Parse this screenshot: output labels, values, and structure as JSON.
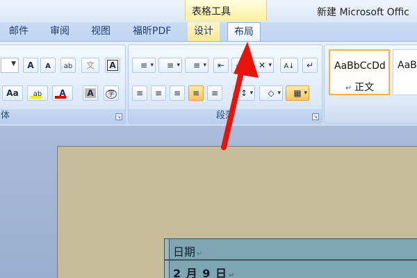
{
  "title_bar": {
    "context_group_label": "表格工具",
    "document_title": "新建 Microsoft Offic"
  },
  "tabs": [
    {
      "label": "邮件"
    },
    {
      "label": "审阅"
    },
    {
      "label": "视图"
    },
    {
      "label": "福昕PDF"
    },
    {
      "label": "设计"
    },
    {
      "label": "布局"
    }
  ],
  "selected_tab": "布局",
  "ribbon": {
    "font_group": {
      "label": "体",
      "buttons": [
        {
          "glyph": "A",
          "icon": "grow-font-icon"
        },
        {
          "glyph": "A",
          "icon": "shrink-font-icon"
        },
        {
          "glyph": "ab",
          "icon": "clear-formatting-icon"
        },
        {
          "glyph": "文",
          "icon": "phonetic-guide-icon"
        },
        {
          "glyph": "A",
          "icon": "character-border-icon"
        },
        {
          "glyph": "Aa",
          "icon": "change-case-icon"
        },
        {
          "glyph": "ab",
          "icon": "text-highlight-icon"
        },
        {
          "glyph": "A",
          "icon": "font-color-icon"
        },
        {
          "glyph": "A",
          "icon": "character-shading-icon"
        },
        {
          "glyph": "字",
          "icon": "enclose-characters-icon"
        }
      ]
    },
    "paragraph_group": {
      "label": "段落",
      "buttons": [
        {
          "glyph": "≡",
          "icon": "bullets-icon"
        },
        {
          "glyph": "≡",
          "icon": "numbering-icon"
        },
        {
          "glyph": "≡",
          "icon": "multilevel-list-icon"
        },
        {
          "glyph": "⇤",
          "icon": "decrease-indent-icon"
        },
        {
          "glyph": "⇥",
          "icon": "increase-indent-icon"
        },
        {
          "glyph": "✕",
          "icon": "chinese-layout-icon"
        },
        {
          "glyph": "A↓",
          "icon": "sort-icon"
        },
        {
          "glyph": "↵",
          "icon": "show-marks-icon"
        },
        {
          "glyph": "≡",
          "icon": "align-left-icon"
        },
        {
          "glyph": "≡",
          "icon": "center-icon"
        },
        {
          "glyph": "≡",
          "icon": "align-right-icon"
        },
        {
          "glyph": "≡",
          "icon": "justify-icon"
        },
        {
          "glyph": "≡",
          "icon": "distributed-icon"
        },
        {
          "glyph": "↕",
          "icon": "line-spacing-icon"
        },
        {
          "glyph": "◇",
          "icon": "shading-icon"
        },
        {
          "glyph": "▦",
          "icon": "borders-icon"
        }
      ]
    },
    "styles_group": {
      "tiles": [
        {
          "sample": "AaBbCcDd",
          "name": "正文",
          "mark": "↵",
          "active": true
        },
        {
          "sample": "AaB",
          "name": "",
          "mark": "",
          "active": false
        }
      ]
    }
  },
  "document": {
    "table_rows": [
      {
        "text": "日期",
        "mark": "↵"
      },
      {
        "text": "2 月 9 日",
        "mark": "↵"
      }
    ]
  },
  "colors": {
    "context_tab": "#fff0a6",
    "arrow": "#e8140c",
    "page": "#c4bc9a",
    "table_cell": "#7fa4b3",
    "highlight_yellow": "#f7f000",
    "font_red": "#e00000"
  }
}
